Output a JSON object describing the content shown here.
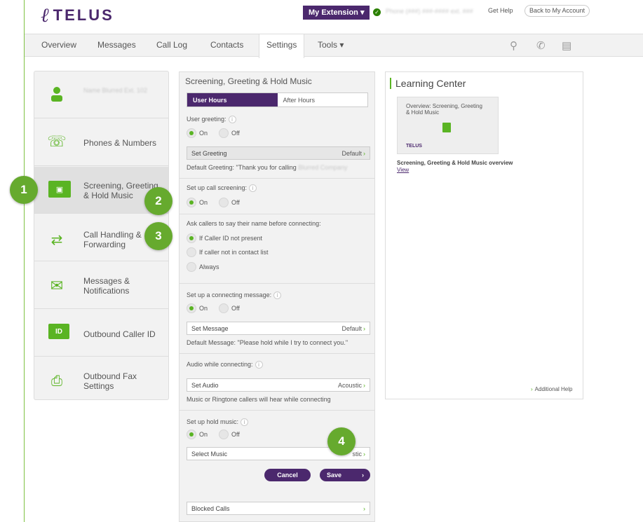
{
  "header": {
    "brand": "TELUS",
    "extension_button": "My Extension ▾",
    "phone_blurred": "Phone (###) ###-#### ext. ###",
    "help": "Get Help",
    "back": "Back to My Account"
  },
  "nav": {
    "items": [
      "Overview",
      "Messages",
      "Call Log",
      "Contacts",
      "Settings",
      "Tools ▾"
    ],
    "active": "Settings"
  },
  "sidebar": {
    "items": [
      {
        "label": "Name Blurred Ext. 102",
        "icon": "user-icon"
      },
      {
        "label": "Phones & Numbers",
        "icon": "phone-grid-icon"
      },
      {
        "label": "Screening, Greeting & Hold Music",
        "icon": "id-card-icon"
      },
      {
        "label": "Call Handling & Forwarding",
        "icon": "call-forward-icon"
      },
      {
        "label": "Messages & Notifications",
        "icon": "envelope-icon"
      },
      {
        "label": "Outbound Caller ID",
        "icon": "id-badge-icon"
      },
      {
        "label": "Outbound Fax Settings",
        "icon": "fax-icon"
      }
    ]
  },
  "badges": [
    "1",
    "2",
    "3",
    "4"
  ],
  "panel": {
    "title": "Screening, Greeting & Hold Music",
    "tab_user": "User Hours",
    "tab_after": "After Hours",
    "user_greeting": "User greeting:",
    "on": "On",
    "off": "Off",
    "set_greeting": "Set Greeting",
    "default": "Default",
    "default_greeting": "Default Greeting: \"Thank you for calling",
    "call_screening": "Set up call screening:",
    "ask_callers": "Ask callers to say their name before connecting:",
    "opt_not_present": "If Caller ID not present",
    "opt_not_contact": "If caller not in contact list",
    "opt_always": "Always",
    "connecting_message": "Set up a connecting message:",
    "set_message": "Set Message",
    "default_message": "Default Message: \"Please hold while I try to connect you.\"",
    "audio_connecting": "Audio while connecting:",
    "set_audio": "Set Audio",
    "acoustic": "Acoustic",
    "audio_note": "Music or Ringtone callers will hear while connecting",
    "hold_music": "Set up hold music:",
    "select_music": "Select Music",
    "acoustic_short": "stic",
    "cancel": "Cancel",
    "save": "Save",
    "blocked_calls": "Blocked Calls"
  },
  "learning": {
    "title": "Learning Center",
    "thumb_text": "Overview: Screening, Greeting & Hold Music",
    "thumb_logo": "TELUS",
    "caption": "Screening, Greeting & Hold Music overview",
    "view": "View",
    "additional_help": "Additional Help"
  },
  "colors": {
    "brand_purple": "#4b286d",
    "brand_green": "#5ab423"
  }
}
